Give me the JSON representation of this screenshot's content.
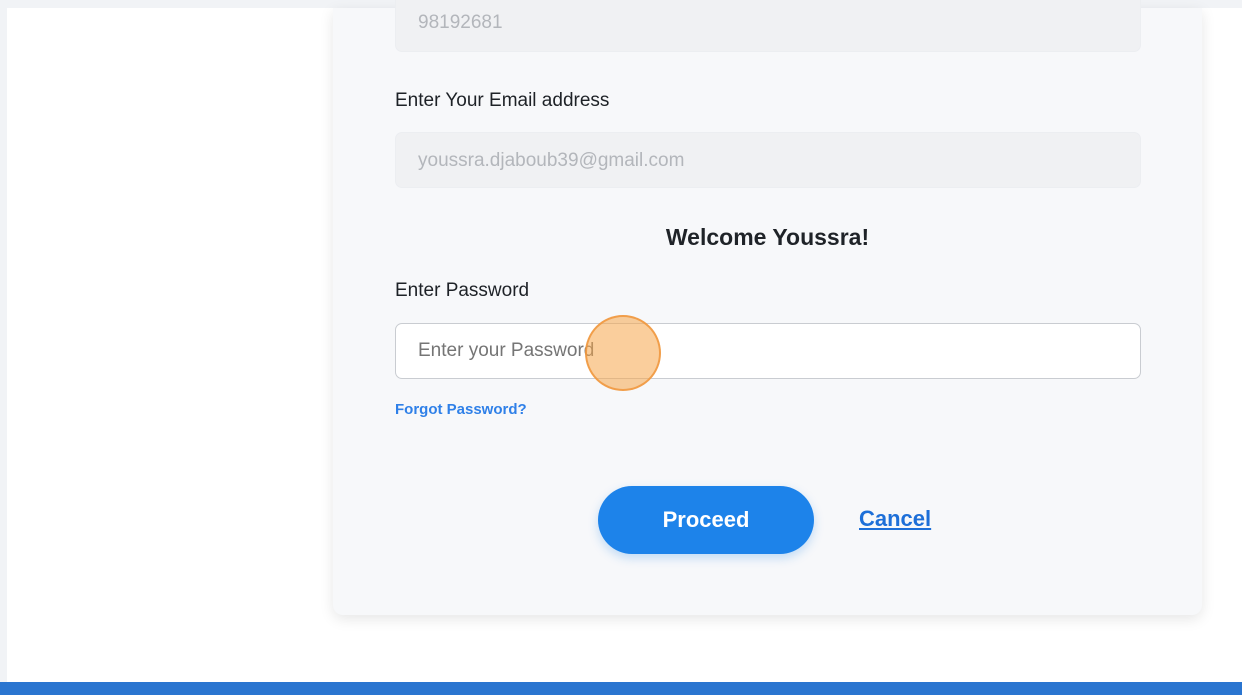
{
  "form": {
    "phone_value": "98192681",
    "email_label": "Enter Your Email address",
    "email_value": "youssra.djaboub39@gmail.com",
    "welcome_text": "Welcome Youssra!",
    "password_label": "Enter Password",
    "password_placeholder": "Enter your Password",
    "forgot_link": "Forgot Password?",
    "proceed_button": "Proceed",
    "cancel_link": "Cancel"
  },
  "colors": {
    "primary": "#1d83ea",
    "link": "#2f80e8",
    "footer": "#2a75d0",
    "click_indicator": "#f5a54b"
  }
}
